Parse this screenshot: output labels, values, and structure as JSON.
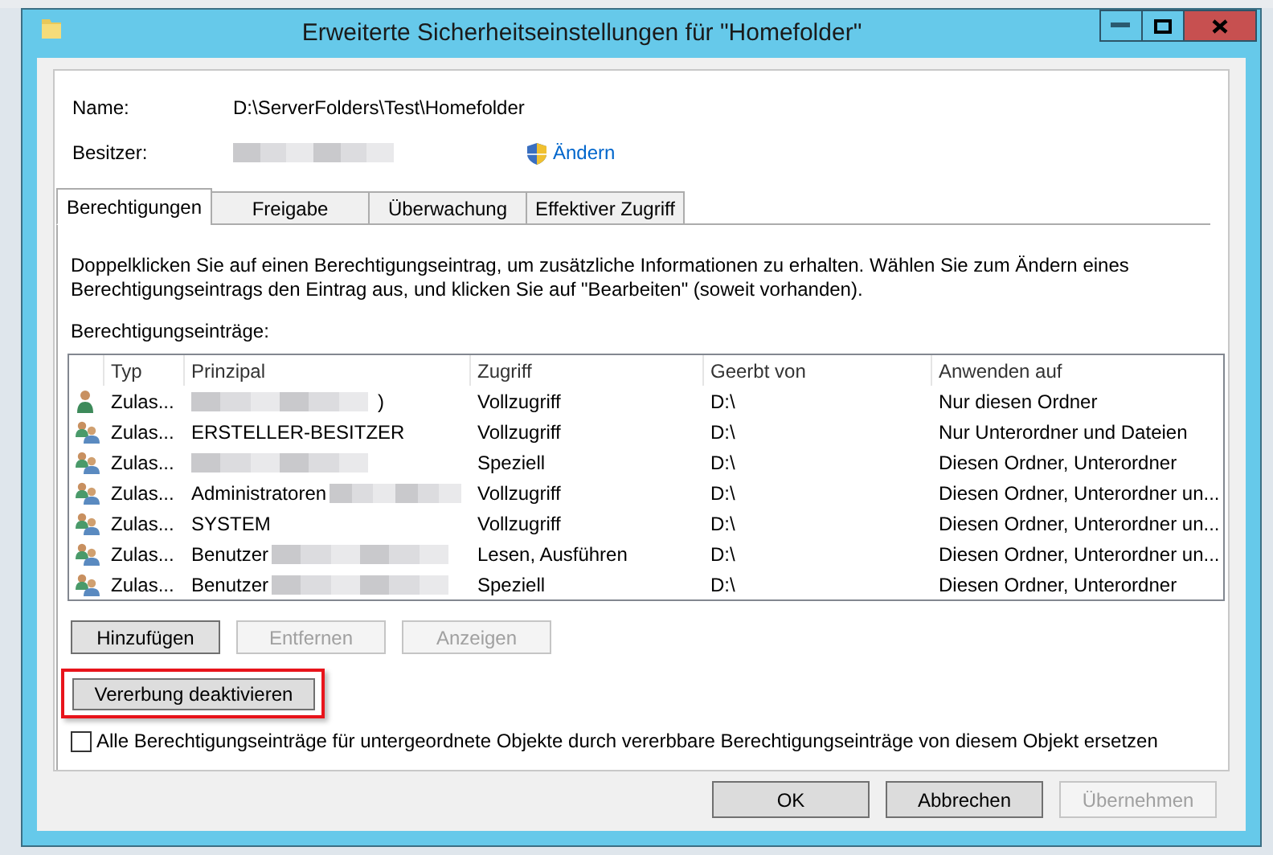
{
  "window": {
    "title": "Erweiterte Sicherheitseinstellungen für \"Homefolder\""
  },
  "name": {
    "label": "Name:",
    "value": "D:\\ServerFolders\\Test\\Homefolder"
  },
  "owner": {
    "label": "Besitzer:",
    "redacted": true,
    "link": "Ändern"
  },
  "tabs": [
    {
      "label": "Berechtigungen",
      "selected": true
    },
    {
      "label": "Freigabe",
      "selected": false
    },
    {
      "label": "Überwachung",
      "selected": false
    },
    {
      "label": "Effektiver Zugriff",
      "selected": false
    }
  ],
  "description": "Doppelklicken Sie auf einen Berechtigungseintrag, um zusätzliche Informationen zu erhalten. Wählen Sie zum Ändern eines Berechtigungseintrags den Eintrag aus, und klicken Sie auf \"Bearbeiten\" (soweit vorhanden).",
  "entries_label": "Berechtigungseinträge:",
  "table": {
    "columns": [
      "Typ",
      "Prinzipal",
      "Zugriff",
      "Geerbt von",
      "Anwenden auf"
    ],
    "rows": [
      {
        "kind": "user",
        "type": "Zulas...",
        "principal": [
          {
            "kind": "blur"
          },
          {
            "kind": "text",
            "text": ")"
          }
        ],
        "access": "Vollzugriff",
        "inherited": "D:\\",
        "applies": "Nur diesen Ordner"
      },
      {
        "kind": "group",
        "type": "Zulas...",
        "principal": [
          {
            "kind": "text",
            "text": "ERSTELLER-BESITZER"
          }
        ],
        "access": "Vollzugriff",
        "inherited": "D:\\",
        "applies": "Nur Unterordner und Dateien"
      },
      {
        "kind": "group",
        "type": "Zulas...",
        "principal": [
          {
            "kind": "blur"
          }
        ],
        "access": "Speziell",
        "inherited": "D:\\",
        "applies": "Diesen Ordner, Unterordner"
      },
      {
        "kind": "group",
        "type": "Zulas...",
        "principal": [
          {
            "kind": "text",
            "text": "Administratoren"
          },
          {
            "kind": "blur"
          }
        ],
        "access": "Vollzugriff",
        "inherited": "D:\\",
        "applies": "Diesen Ordner, Unterordner un..."
      },
      {
        "kind": "group",
        "type": "Zulas...",
        "principal": [
          {
            "kind": "text",
            "text": "SYSTEM"
          }
        ],
        "access": "Vollzugriff",
        "inherited": "D:\\",
        "applies": "Diesen Ordner, Unterordner un..."
      },
      {
        "kind": "group",
        "type": "Zulas...",
        "principal": [
          {
            "kind": "text",
            "text": "Benutzer"
          },
          {
            "kind": "blur"
          }
        ],
        "access": "Lesen, Ausführen",
        "inherited": "D:\\",
        "applies": "Diesen Ordner, Unterordner un..."
      },
      {
        "kind": "group",
        "type": "Zulas...",
        "principal": [
          {
            "kind": "text",
            "text": "Benutzer"
          },
          {
            "kind": "blur"
          }
        ],
        "access": "Speziell",
        "inherited": "D:\\",
        "applies": "Diesen Ordner, Unterordner"
      }
    ]
  },
  "entry_buttons": [
    {
      "label": "Hinzufügen",
      "disabled": false
    },
    {
      "label": "Entfernen",
      "disabled": true
    },
    {
      "label": "Anzeigen",
      "disabled": true
    }
  ],
  "inheritance_button": {
    "label": "Vererbung deaktivieren",
    "highlighted": true
  },
  "replace_checkbox": {
    "label": "Alle Berechtigungseinträge für untergeordnete Objekte durch vererbbare Berechtigungseinträge von diesem Objekt ersetzen",
    "checked": false
  },
  "footer_buttons": [
    {
      "label": "OK",
      "disabled": false
    },
    {
      "label": "Abbrechen",
      "disabled": false
    },
    {
      "label": "Übernehmen",
      "disabled": true
    }
  ]
}
